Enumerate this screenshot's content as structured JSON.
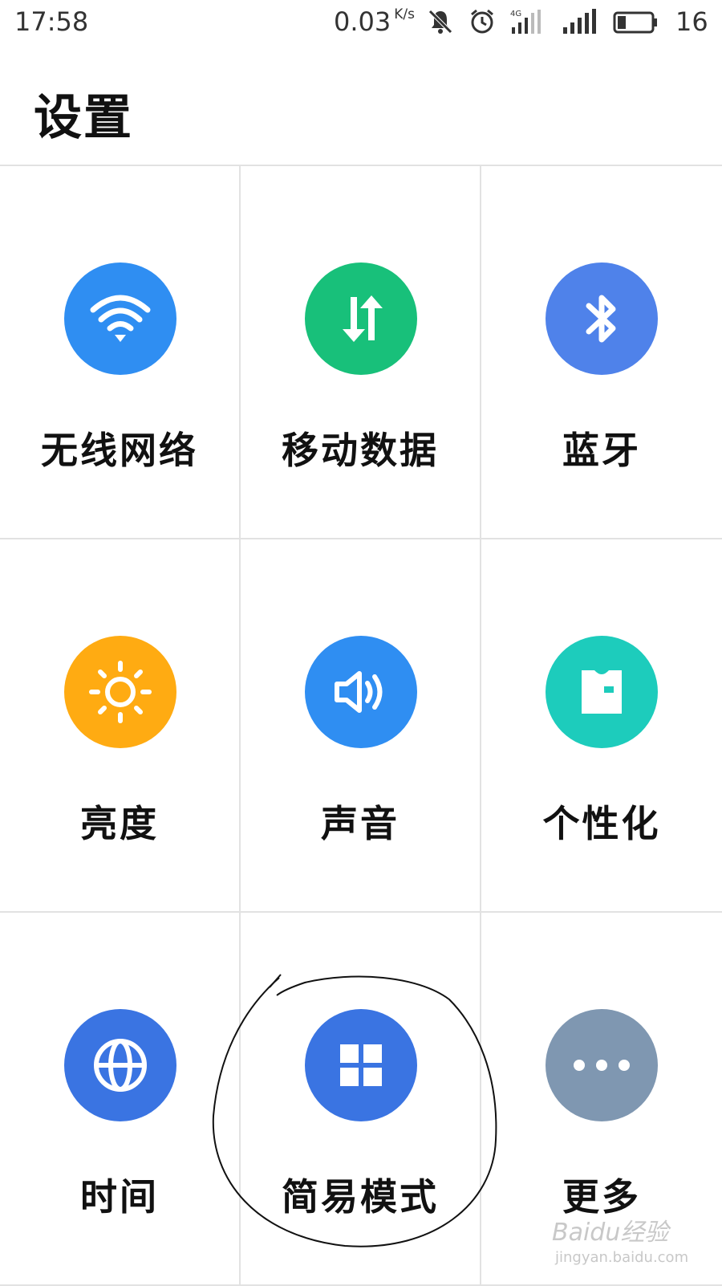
{
  "status_bar": {
    "time": "17:58",
    "speed": "0.03",
    "speed_unit": "K/s",
    "network_label": "4G",
    "battery": "16"
  },
  "page": {
    "title": "设置"
  },
  "tiles": [
    {
      "label": "无线网络",
      "icon": "wifi-icon",
      "color": "#2f8ef2"
    },
    {
      "label": "移动数据",
      "icon": "mobile-data-icon",
      "color": "#18c07a"
    },
    {
      "label": "蓝牙",
      "icon": "bluetooth-icon",
      "color": "#4f82ea"
    },
    {
      "label": "亮度",
      "icon": "brightness-icon",
      "color": "#ffab12"
    },
    {
      "label": "声音",
      "icon": "sound-icon",
      "color": "#2f8ef2"
    },
    {
      "label": "个性化",
      "icon": "personalize-icon",
      "color": "#1dccbc"
    },
    {
      "label": "时间",
      "icon": "globe-icon",
      "color": "#3a74e2"
    },
    {
      "label": "简易模式",
      "icon": "grid-icon",
      "color": "#3a74e2"
    },
    {
      "label": "更多",
      "icon": "more-icon",
      "color": "#7f97b1"
    }
  ],
  "watermark": {
    "brand": "Baidu经验",
    "url": "jingyan.baidu.com"
  }
}
